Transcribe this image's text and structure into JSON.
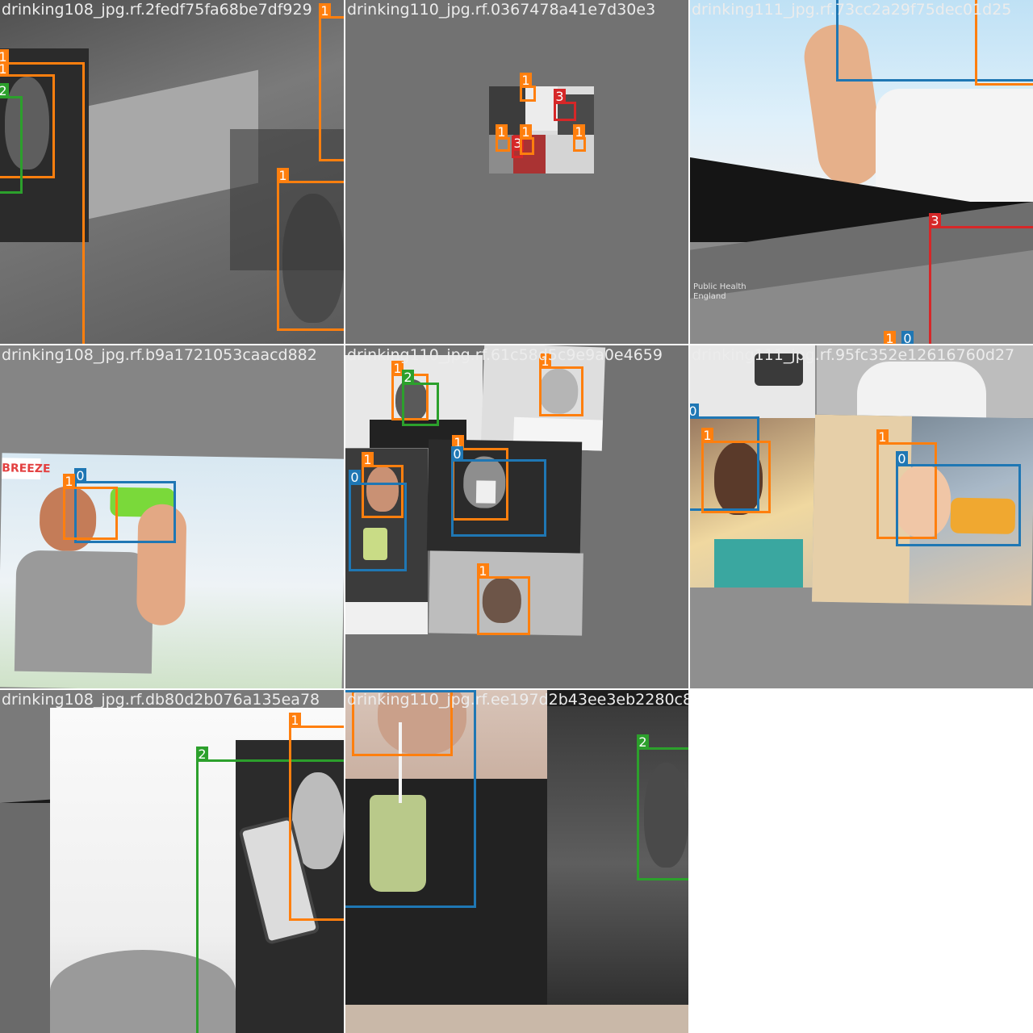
{
  "grid_title": "",
  "class_colors": {
    "0": "#1f77b4",
    "1": "#ff7f0e",
    "2": "#2ca02c",
    "3": "#d62728"
  },
  "tiles": [
    {
      "filename": "drinking108_jpg.rf.2fedf75fa68be7df929",
      "labels": [
        "1",
        "1",
        "2",
        "1",
        "1"
      ]
    },
    {
      "filename": "drinking110_jpg.rf.0367478a41e7d30e3",
      "labels": [
        "1",
        "3",
        "1",
        "3",
        "1",
        "1"
      ]
    },
    {
      "filename": "drinking111_jpg.rf.73cc2a29f75dec01d25",
      "labels": [
        "3",
        "1",
        "0"
      ]
    },
    {
      "filename": "drinking108_jpg.rf.b9a1721053caacd882",
      "labels": [
        "0",
        "1"
      ]
    },
    {
      "filename": "drinking110_jpg.rf.61c58d5c9e9a0e4659",
      "labels": [
        "1",
        "2",
        "1",
        "1",
        "0",
        "1",
        "0",
        "1"
      ],
      "photo_text": "BREEZE"
    },
    {
      "filename": "drinking111_jpg.rf.95fc352e12616760d27",
      "labels": [
        "0",
        "1",
        "1",
        "0"
      ]
    },
    {
      "filename": "drinking108_jpg.rf.db80d2b076a135ea78",
      "labels": [
        "1",
        "2"
      ]
    },
    {
      "filename": "drinking110_jpg.rf.ee197d2b43ee3eb2280c8",
      "labels": [
        "1",
        "0",
        "2"
      ]
    }
  ],
  "overlay_text": {
    "public_health": "Public Health",
    "england": "England"
  }
}
